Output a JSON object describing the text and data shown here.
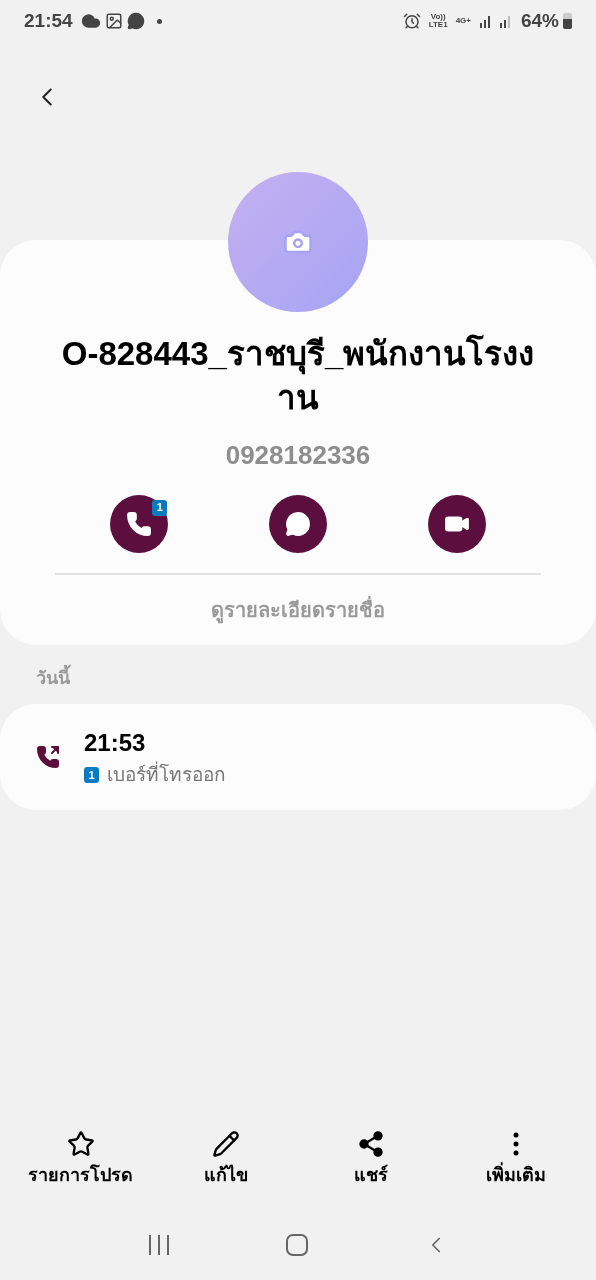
{
  "status_bar": {
    "time": "21:54",
    "volte": "Vo))",
    "lte": "LTE1",
    "network": "4G+",
    "battery": "64%"
  },
  "contact": {
    "name": "O-828443_ราชบุรี_พนักงานโรงงาน",
    "phone": "0928182336",
    "sim_badge": "1",
    "details_link": "ดูรายละเอียดรายชื่อ"
  },
  "actions": [
    {
      "kind": "call"
    },
    {
      "kind": "message"
    },
    {
      "kind": "video"
    }
  ],
  "history": {
    "heading": "วันนี้",
    "items": [
      {
        "time": "21:53",
        "sim": "1",
        "label": "เบอร์ที่โทรออก"
      }
    ]
  },
  "bottom_bar": [
    {
      "kind": "star",
      "label": "รายการโปรด"
    },
    {
      "kind": "edit",
      "label": "แก้ไข"
    },
    {
      "kind": "share",
      "label": "แชร์"
    },
    {
      "kind": "more",
      "label": "เพิ่มเติม"
    }
  ]
}
